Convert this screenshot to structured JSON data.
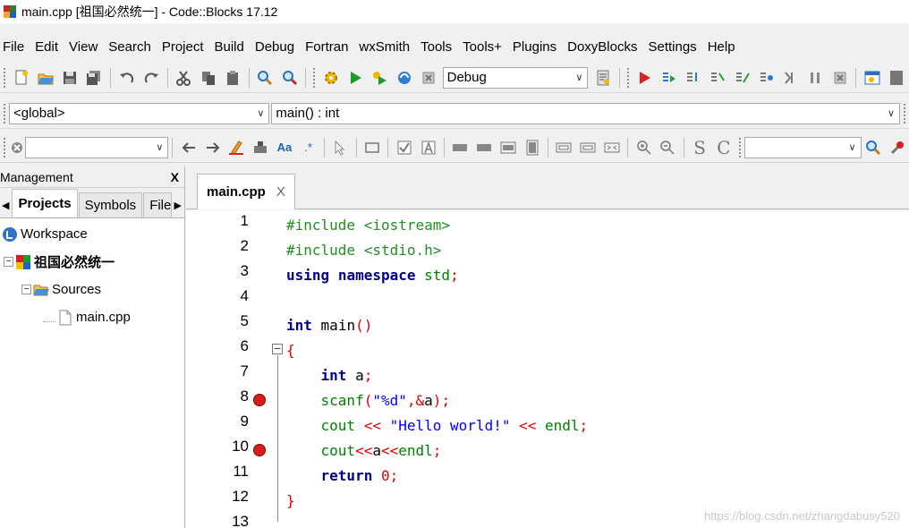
{
  "window": {
    "title": "main.cpp [祖国必然统一] - Code::Blocks 17.12"
  },
  "menu": [
    "File",
    "Edit",
    "View",
    "Search",
    "Project",
    "Build",
    "Debug",
    "Fortran",
    "wxSmith",
    "Tools",
    "Tools+",
    "Plugins",
    "DoxyBlocks",
    "Settings",
    "Help"
  ],
  "toolbar": {
    "build_target": "Debug",
    "scope_combo": "<global>",
    "function_combo": "main() : int",
    "search_combo": "",
    "regex_label": ".*",
    "aa_label": "Aa",
    "s_label": "S",
    "c_label": "C"
  },
  "management": {
    "title": "Management",
    "close": "X",
    "tabs": [
      "Projects",
      "Symbols",
      "Files"
    ],
    "active_tab": "Projects",
    "tree": {
      "workspace": "Workspace",
      "project": "祖国必然统一",
      "folder": "Sources",
      "file": "main.cpp"
    }
  },
  "editor": {
    "tab_label": "main.cpp",
    "tab_close": "X",
    "breakpoint_lines": [
      8,
      10
    ],
    "lines": [
      {
        "n": "1",
        "text": "#include <iostream>"
      },
      {
        "n": "2",
        "text": "#include <stdio.h>"
      },
      {
        "n": "3",
        "text": "using namespace std;"
      },
      {
        "n": "4",
        "text": ""
      },
      {
        "n": "5",
        "text": "int main()"
      },
      {
        "n": "6",
        "text": "{"
      },
      {
        "n": "7",
        "text": "    int a;"
      },
      {
        "n": "8",
        "text": "    scanf(\"%d\",&a);"
      },
      {
        "n": "9",
        "text": "    cout << \"Hello world!\" << endl;"
      },
      {
        "n": "10",
        "text": "    cout<<a<<endl;"
      },
      {
        "n": "11",
        "text": "    return 0;"
      },
      {
        "n": "12",
        "text": "}"
      },
      {
        "n": "13",
        "text": ""
      }
    ]
  },
  "watermark": "https://blog.csdn.net/zhangdabusy520",
  "colors": {
    "keyword": "#00008b",
    "preprocessor": "#238e23",
    "string": "#0000ff",
    "operator": "#e00000",
    "breakpoint": "#d62020"
  }
}
